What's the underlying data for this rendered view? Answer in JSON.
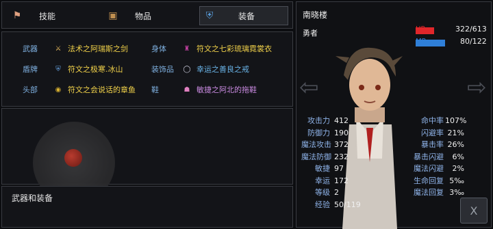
{
  "tabs": [
    {
      "label": "技能",
      "icon": "flag-icon"
    },
    {
      "label": "物品",
      "icon": "chest-icon"
    },
    {
      "label": "装备",
      "icon": "shield-icon",
      "active": true
    }
  ],
  "equipment": {
    "weapon": {
      "slot": "武器",
      "name": "法术之阿瑞斯之剑",
      "color": "#f2d24a"
    },
    "shield": {
      "slot": "盾牌",
      "name": "符文之极寒.冰山",
      "color": "#f2d24a"
    },
    "head": {
      "slot": "头部",
      "name": "符文之会说话的章鱼",
      "color": "#f2d24a"
    },
    "body": {
      "slot": "身体",
      "name": "符文之七彩琉璃霓裳衣",
      "color": "#f2d24a"
    },
    "accessory": {
      "slot": "装饰品",
      "name": "幸运之善良之戒",
      "color": "#6ab4e8"
    },
    "shoes": {
      "slot": "鞋",
      "name": "敏捷之阿北的拖鞋",
      "color": "#c98ae0"
    }
  },
  "description": "武器和装备",
  "hero": {
    "name": "南晓楼",
    "class": "勇者",
    "hp_label": "HP",
    "hp_value": "322/613",
    "hp_fraction": 0.525,
    "mp_label": "MP",
    "mp_value": "80/122",
    "mp_fraction": 0.656
  },
  "stats_left": [
    {
      "k": "攻击力",
      "v": "412"
    },
    {
      "k": "防御力",
      "v": "190"
    },
    {
      "k": "魔法攻击",
      "v": "372"
    },
    {
      "k": "魔法防御",
      "v": "232"
    },
    {
      "k": "敏捷",
      "v": "97"
    },
    {
      "k": "幸运",
      "v": "172"
    },
    {
      "k": "等级",
      "v": "2"
    },
    {
      "k": "经验",
      "v": "50/119"
    }
  ],
  "stats_right": [
    {
      "k": "命中率",
      "v": "107%"
    },
    {
      "k": "闪避率",
      "v": "21%"
    },
    {
      "k": "暴击率",
      "v": "26%"
    },
    {
      "k": "暴击闪避",
      "v": "6%"
    },
    {
      "k": "魔法闪避",
      "v": "2%"
    },
    {
      "k": "生命回复",
      "v": "5‰"
    },
    {
      "k": "魔法回复",
      "v": "3‰"
    }
  ],
  "close_label": "X",
  "colors": {
    "hp": "#e0262a",
    "mp": "#2f7fd8",
    "label": "#8fb4ea"
  }
}
